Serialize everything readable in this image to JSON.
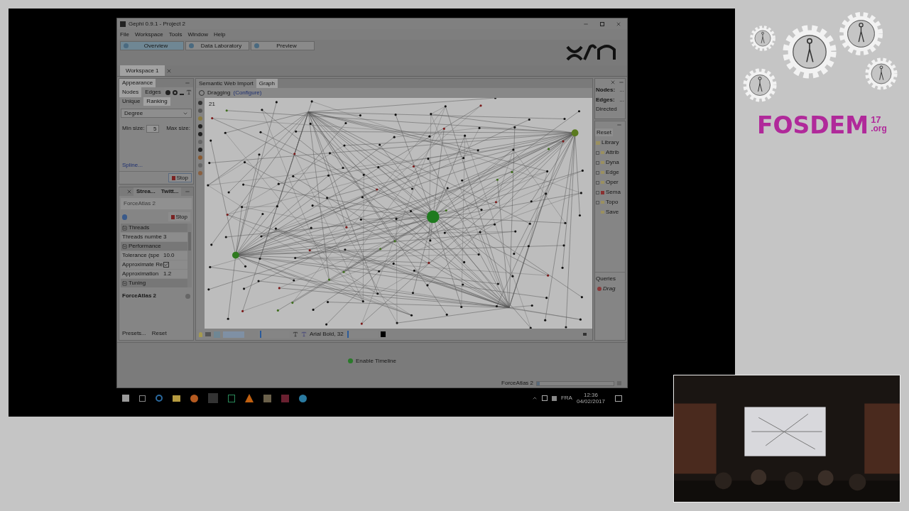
{
  "window": {
    "title": "Gephi 0.9.1 - Project 2"
  },
  "menu": [
    "File",
    "Workspace",
    "Tools",
    "Window",
    "Help"
  ],
  "modes": [
    {
      "label": "Overview",
      "selected": true
    },
    {
      "label": "Data Laboratory",
      "selected": false
    },
    {
      "label": "Preview",
      "selected": false
    }
  ],
  "workspace_tabs": [
    {
      "label": "Workspace 1",
      "selected": true
    }
  ],
  "appearance": {
    "title": "Appearance",
    "element_tabs": [
      {
        "label": "Nodes",
        "selected": true
      },
      {
        "label": "Edges",
        "selected": false
      }
    ],
    "mode_tabs": [
      {
        "label": "Unique",
        "selected": false
      },
      {
        "label": "Ranking",
        "selected": true
      }
    ],
    "attribute": "Degree",
    "min_label": "Min size:",
    "min_value": "5",
    "max_label": "Max size:",
    "spline": "Spline...",
    "stop": "Stop"
  },
  "layout": {
    "tabs": [
      {
        "label": "Strea...",
        "selected": false
      },
      {
        "label": "Twitt...",
        "selected": false
      }
    ],
    "algorithm": "ForceAtlas 2",
    "stop": "Stop",
    "properties": [
      {
        "kind": "category",
        "label": "Threads"
      },
      {
        "kind": "value",
        "label": "Threads numbe",
        "value": "3"
      },
      {
        "kind": "category",
        "label": "Performance"
      },
      {
        "kind": "value",
        "label": "Tolerance (spe",
        "value": "10.0"
      },
      {
        "kind": "check",
        "label": "Approximate Re",
        "checked": true
      },
      {
        "kind": "value",
        "label": "Approximation",
        "value": "1.2"
      },
      {
        "kind": "category",
        "label": "Tuning"
      }
    ],
    "description_title": "ForceAtlas 2",
    "presets": "Presets...",
    "reset": "Reset"
  },
  "graph": {
    "tabs": [
      {
        "label": "Semantic Web Import",
        "selected": false
      },
      {
        "label": "Graph",
        "selected": true
      }
    ],
    "tool": "Dragging",
    "configure": "(Configure)",
    "counter": "21",
    "font": "Arial Bold, 32",
    "size_slider": {
      "level": 0.05
    },
    "font_slider": {
      "level": 0.03
    }
  },
  "context": {
    "nodes_label": "Nodes:",
    "nodes_value": "...",
    "edges_label": "Edges:",
    "edges_value": "...",
    "type": "Directed"
  },
  "filters": {
    "reset": "Reset",
    "root": "Library",
    "children": [
      {
        "label": "Attrib",
        "kind": "folder"
      },
      {
        "label": "Dyna",
        "kind": "folder"
      },
      {
        "label": "Edge",
        "kind": "folder"
      },
      {
        "label": "Oper",
        "kind": "folder"
      },
      {
        "label": "Sema",
        "kind": "plugin"
      },
      {
        "label": "Topo",
        "kind": "folder"
      },
      {
        "label": "Save",
        "kind": "leaf"
      }
    ],
    "queries": "Queries",
    "query_items": [
      "Drag"
    ]
  },
  "timeline": {
    "label": "Enable Timeline"
  },
  "status": {
    "task": "ForceAtlas 2",
    "progress": {
      "level": 0.04
    }
  },
  "taskbar": {
    "language": "FRA",
    "time": "12:36",
    "date": "04/02/2017"
  },
  "branding": {
    "name": "FOSDEM",
    "year": "17",
    "domain": ".org"
  }
}
